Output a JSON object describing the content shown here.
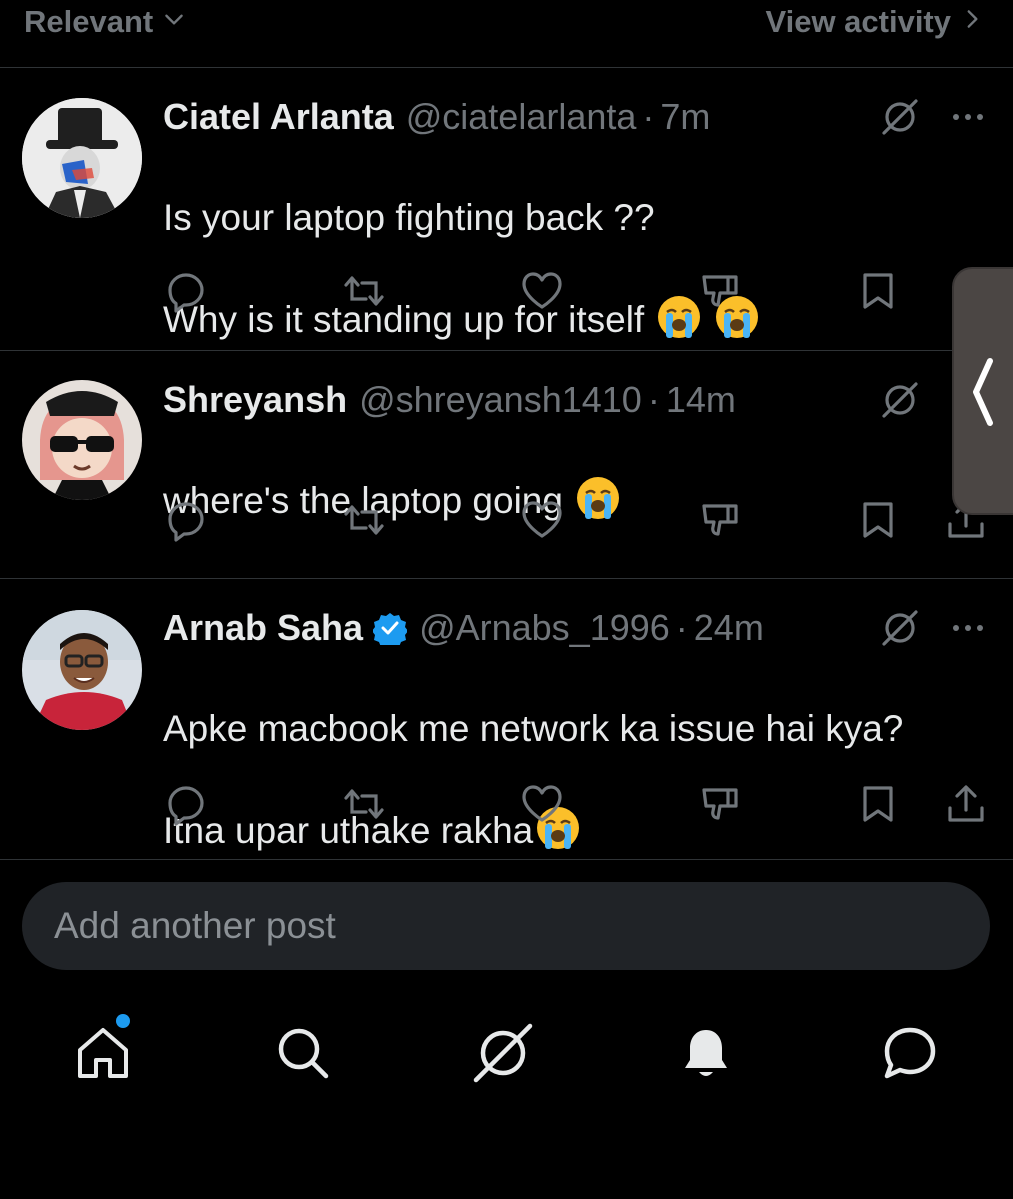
{
  "topbar": {
    "sort_label": "Relevant",
    "view_activity_label": "View activity"
  },
  "posts": [
    {
      "name": "Ciatel Arlanta",
      "handle": "@ciatelarlanta",
      "time": "7m",
      "verified": false,
      "lines": [
        "Is your laptop fighting back ??",
        "Why is it standing up for itself"
      ],
      "emoji": "loudly-crying-face x2"
    },
    {
      "name": "Shreyansh",
      "handle": "@shreyansh1410",
      "time": "14m",
      "verified": false,
      "lines": [
        "where's the laptop going"
      ],
      "emoji": "loudly-crying-face"
    },
    {
      "name": "Arnab Saha",
      "handle": "@Arnabs_1996",
      "time": "24m",
      "verified": true,
      "lines": [
        "Apke macbook me network ka issue hai kya?",
        "Itna upar uthake rakha"
      ],
      "emoji": "loudly-crying-face"
    }
  ],
  "separator": "·",
  "composer": {
    "placeholder": "Add another post"
  },
  "nav": {
    "items": [
      "home-icon",
      "search-icon",
      "grok-icon",
      "notifications-bell-icon",
      "messages-icon"
    ],
    "home_has_badge": true
  },
  "colors": {
    "background": "#000000",
    "text_primary": "#e7e9ea",
    "text_secondary": "#71767b",
    "accent_blue": "#1d9bf0",
    "divider": "#2f3336",
    "composer_bg": "#202327"
  }
}
